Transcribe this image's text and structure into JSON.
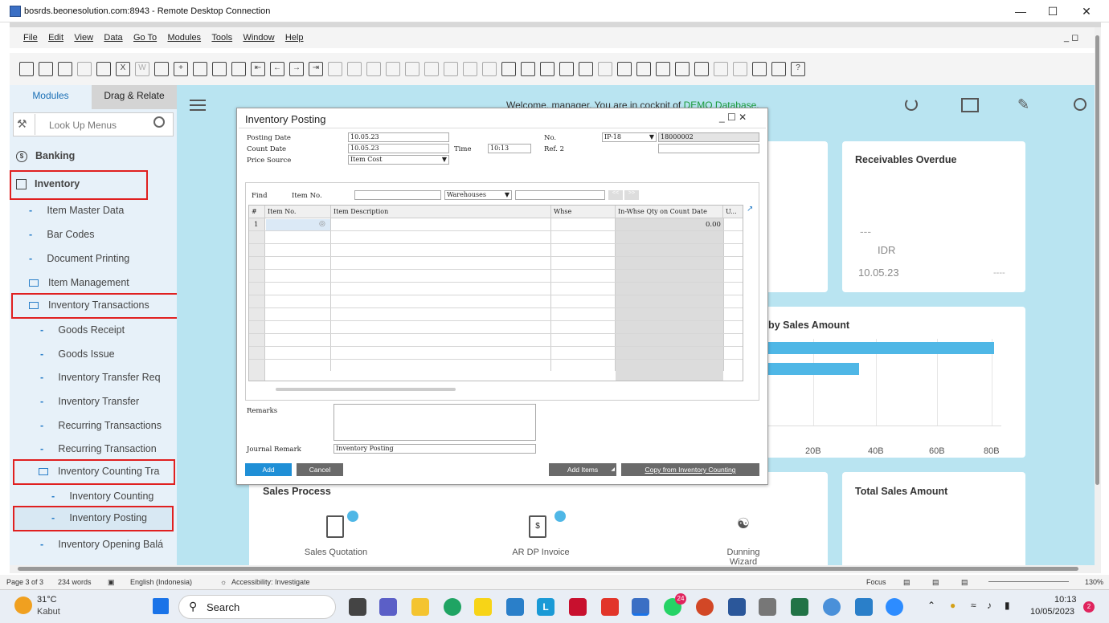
{
  "window": {
    "title": "bosrds.beonesolution.com:8943 - Remote Desktop Connection"
  },
  "menubar": {
    "items": [
      "File",
      "Edit",
      "View",
      "Data",
      "Go To",
      "Modules",
      "Tools",
      "Window",
      "Help"
    ]
  },
  "left": {
    "tab_modules": "Modules",
    "tab_drag": "Drag & Relate",
    "lookup_placeholder": "Look Up Menus",
    "banking": "Banking",
    "inventory": "Inventory",
    "items": [
      "Item Master Data",
      "Bar Codes",
      "Document Printing",
      "Item Management",
      "Inventory Transactions",
      "Goods Receipt",
      "Goods Issue",
      "Inventory Transfer Req",
      "Inventory Transfer",
      "Recurring Transactions",
      "Recurring Transaction",
      "Inventory Counting Tra",
      "Inventory Counting",
      "Inventory Posting",
      "Inventory Opening Balá"
    ]
  },
  "dashboard": {
    "welcome": "Welcome, manager. You are in cockpit of",
    "db_link": "DEMO Database",
    "receivables_title": "Receivables Overdue",
    "rec_dashes": "---",
    "rec_currency": "IDR",
    "rec_date": "10.05.23",
    "rec_dash2": "----",
    "sales_amt_title": "ns by Sales Amount",
    "axis_labels": [
      "20B",
      "40B",
      "60B",
      "80B"
    ],
    "sales_process": "Sales Process",
    "sq_label": "Sales Quotation",
    "ardp_label": "AR DP Invoice",
    "dunning_label": "Dunning Wizard",
    "total_sales": "Total Sales Amount",
    "bar_fractions": [
      0.97,
      0.39
    ]
  },
  "dialog": {
    "title": "Inventory Posting",
    "posting_date_label": "Posting Date",
    "posting_date": "10.05.23",
    "count_date_label": "Count Date",
    "count_date": "10.05.23",
    "time_label": "Time",
    "time": "10:13",
    "price_source_label": "Price Source",
    "price_source": "Item Cost",
    "no_label": "No.",
    "no_series": "IP-18",
    "no_value": "18000002",
    "ref2_label": "Ref. 2",
    "find_label": "Find",
    "itemno_label": "Item No.",
    "warehouses": "Warehouses",
    "columns": [
      "#",
      "Item No.",
      "Item Description",
      "Whse",
      "In-Whse Qty on Count Date",
      "U..."
    ],
    "row1_num": "1",
    "row1_qty": "0.00",
    "remarks_label": "Remarks",
    "journal_label": "Journal Remark",
    "journal_value": "Inventory Posting",
    "add": "Add",
    "cancel": "Cancel",
    "add_items": "Add Items",
    "copy_from": "Copy from Inventory Counting"
  },
  "status": {
    "page": "Page 3 of 3",
    "words": "234 words",
    "lang": "English (Indonesia)",
    "access": "Accessibility: Investigate",
    "focus": "Focus",
    "zoom": "130%"
  },
  "taskbar": {
    "temp": "31°C",
    "weather": "Kabut",
    "search": "Search",
    "badge": "24",
    "time": "10:13",
    "date": "10/05/2023",
    "notif": "2"
  }
}
